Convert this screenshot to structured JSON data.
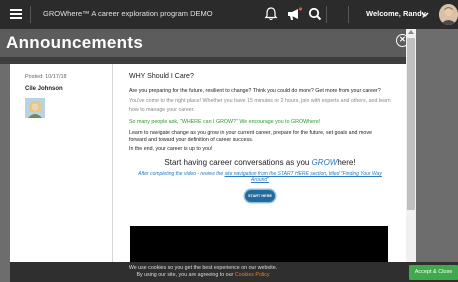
{
  "topbar": {
    "brand": "GROWhere™ A career exploration program DEMO",
    "welcome": "Welcome, Randy",
    "icons": [
      "menu-icon",
      "bell-icon",
      "megaphone-icon",
      "search-icon",
      "chevron-down-icon"
    ]
  },
  "modal": {
    "title": "Announcements",
    "close_label": "✕"
  },
  "post": {
    "posted": "Posted: 10/17/18",
    "author": "Cile Johnson"
  },
  "article": {
    "heading": "WHY Should I Care?",
    "p1": "Are you preparing for the future, resilient to change? Think you could do more? Get more from your career?",
    "p2": "You've come to the right place! Whether you have 15 minutes or 2 hours, join with experts and others, and learn how to manage your career.",
    "p3": "So many people ask, \"WHERE can I GROW?\" We encourage you to GROWhere!",
    "p4": "Learn to navigate change as you grow in your current career, prepare for the future, set goals and move forward and toward your definition of career success.",
    "p5": "In the end, your career is up to you!",
    "big_pre": "Start having career conversations as you ",
    "big_brand": "GROW",
    "big_post": "here!",
    "after_pre": "After completing the video - review the ",
    "after_link": "site navigation from the START HERE section, titled \"Finding Your Way Around\"",
    "start_button": "START HERE"
  },
  "cookie": {
    "line1": "We use cookies so you get the best experience on our website.",
    "line2_pre": "By using our site, you are agreeing to our ",
    "line2_link": "Cookies Policy",
    "accept_label": "Accept & Close"
  },
  "colors": {
    "topbar": "#2b2b2b",
    "green_text": "#2e9a2e",
    "link_blue": "#2a7ac1",
    "accept_green": "#3fa94b",
    "cookie_link": "#e67e22"
  }
}
